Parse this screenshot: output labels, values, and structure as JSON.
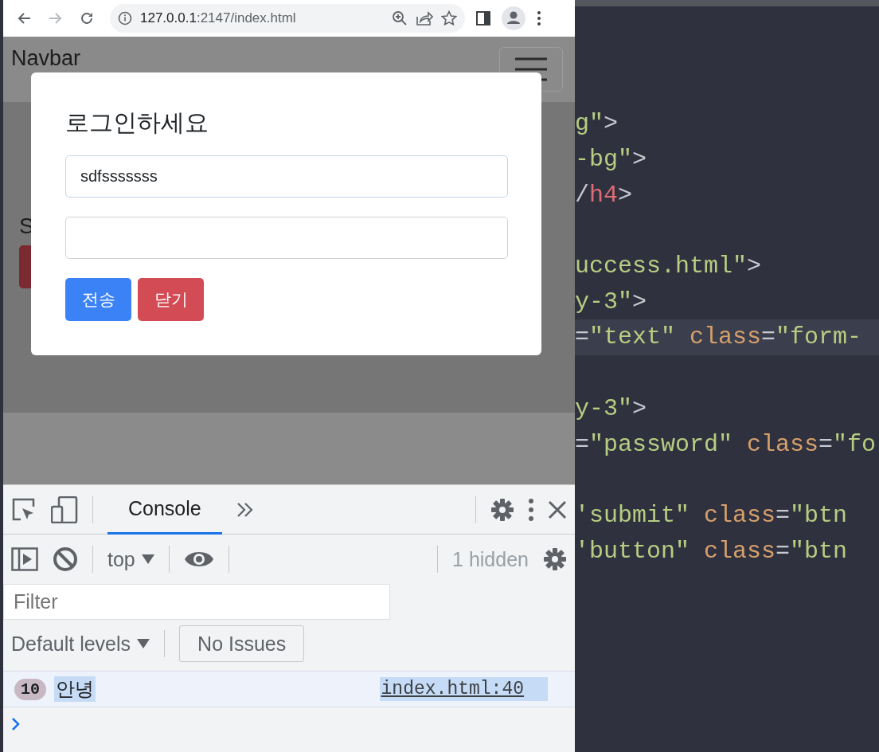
{
  "browser": {
    "nav_buttons": [
      {
        "kind": "back",
        "disabled": false
      },
      {
        "kind": "forward",
        "disabled": true
      },
      {
        "kind": "reload",
        "disabled": false
      }
    ],
    "url_host": "127.0.0.1",
    "url_path": ":2147/index.html"
  },
  "page": {
    "navbar_brand": "Navbar",
    "heading_fragment": "S",
    "modal": {
      "title": "로그인하세요",
      "fields": [
        {
          "kind": "text",
          "value": "sdfsssssss"
        },
        {
          "kind": "password"
        }
      ],
      "buttons": [
        {
          "label": "전송",
          "kind": "primary"
        },
        {
          "label": "닫기",
          "kind": "danger"
        }
      ]
    }
  },
  "devtools": {
    "tabs": [
      {
        "label": "Console",
        "selected": true
      }
    ],
    "context": "top",
    "hidden_count": "1 hidden",
    "filter_placeholder": "Filter",
    "levels": "Default levels",
    "issues": "No Issues",
    "messages": [
      {
        "count": "10",
        "text": "안녕",
        "source": "index.html:40",
        "selected": true
      }
    ]
  },
  "editor": {
    "lines": [
      {
        "current": false,
        "tokens": [
          {
            "kind": "string",
            "text": "g\""
          },
          {
            "kind": "punct",
            "text": ">"
          }
        ]
      },
      {
        "current": false,
        "tokens": [
          {
            "kind": "string",
            "text": "-bg\""
          },
          {
            "kind": "punct",
            "text": ">"
          }
        ]
      },
      {
        "current": false,
        "tokens": [
          {
            "kind": "punct",
            "text": "/"
          },
          {
            "kind": "tag",
            "text": "h4"
          },
          {
            "kind": "punct",
            "text": ">"
          }
        ]
      },
      {
        "current": false
      },
      {
        "current": false,
        "tokens": [
          {
            "kind": "string",
            "text": "uccess.html\""
          },
          {
            "kind": "punct",
            "text": ">"
          }
        ]
      },
      {
        "current": false,
        "tokens": [
          {
            "kind": "string",
            "text": "y-3\""
          },
          {
            "kind": "punct",
            "text": ">"
          }
        ]
      },
      {
        "current": true,
        "tokens": [
          {
            "kind": "punct",
            "text": "="
          },
          {
            "kind": "string",
            "text": "\"text\""
          },
          {
            "kind": "attr",
            "text": "class"
          },
          {
            "kind": "punct",
            "text": "="
          },
          {
            "kind": "string",
            "text": "\"form-"
          }
        ]
      },
      {
        "current": false
      },
      {
        "current": false,
        "tokens": [
          {
            "kind": "string",
            "text": "y-3\""
          },
          {
            "kind": "punct",
            "text": ">"
          }
        ]
      },
      {
        "current": false,
        "tokens": [
          {
            "kind": "punct",
            "text": "="
          },
          {
            "kind": "string",
            "text": "\"password\""
          },
          {
            "kind": "attr",
            "text": "class"
          },
          {
            "kind": "punct",
            "text": "="
          },
          {
            "kind": "string",
            "text": "\"fo"
          }
        ]
      },
      {
        "current": false
      },
      {
        "current": false,
        "tokens": [
          {
            "kind": "string",
            "text": "'submit\""
          },
          {
            "kind": "attr",
            "text": "class"
          },
          {
            "kind": "punct",
            "text": "="
          },
          {
            "kind": "string",
            "text": "\"btn"
          }
        ]
      },
      {
        "current": false,
        "tokens": [
          {
            "kind": "string",
            "text": "'button\""
          },
          {
            "kind": "attr",
            "text": "class"
          },
          {
            "kind": "punct",
            "text": "="
          },
          {
            "kind": "string",
            "text": "\"btn"
          }
        ]
      }
    ]
  }
}
